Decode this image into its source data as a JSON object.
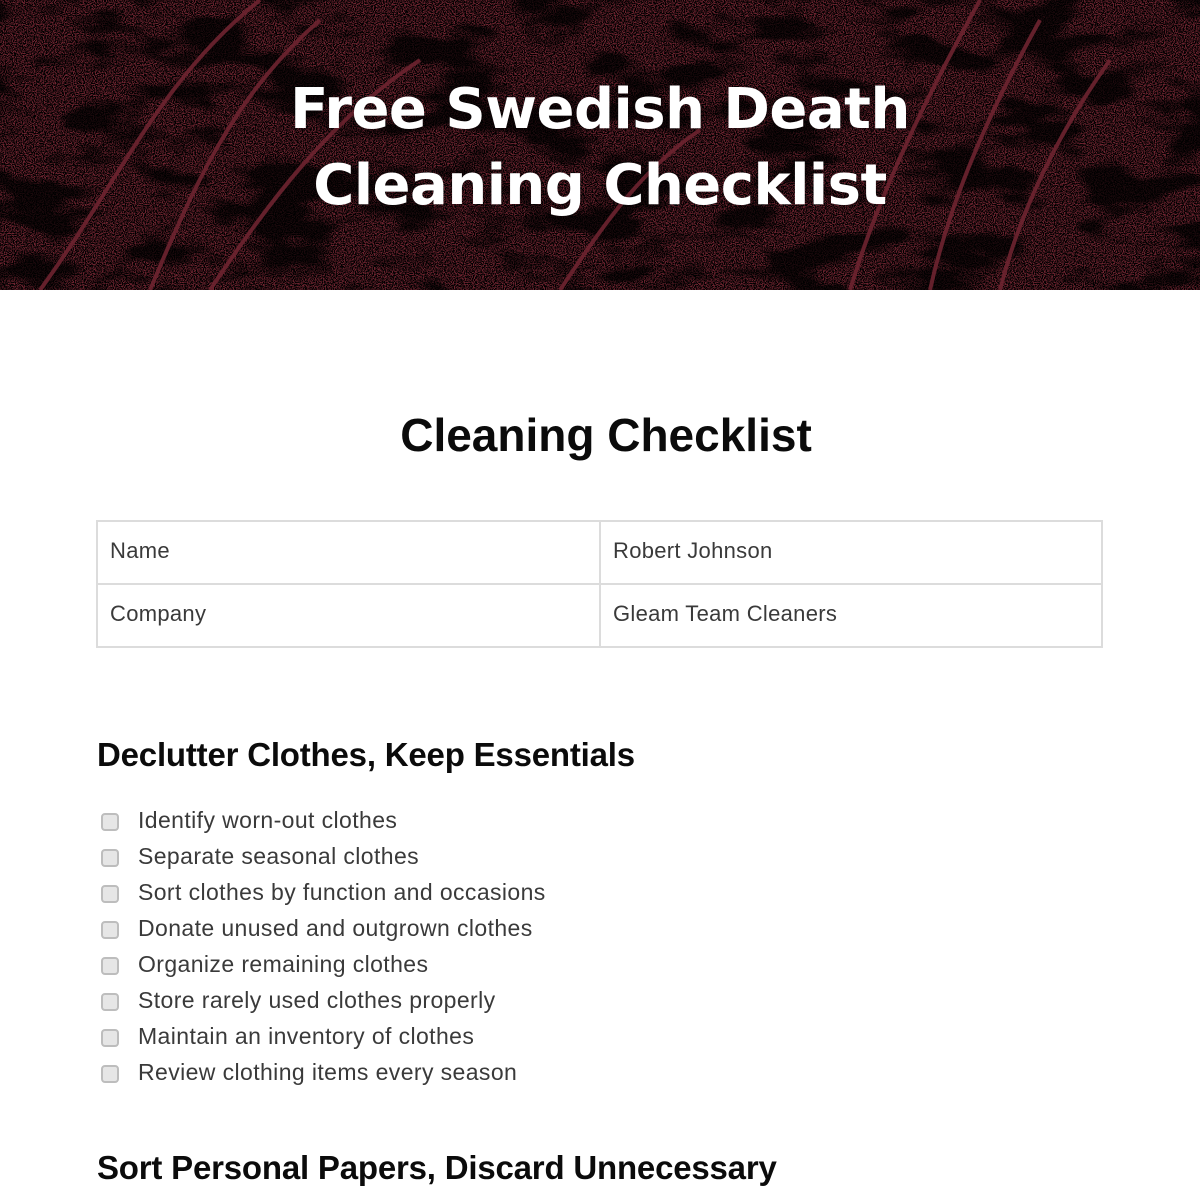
{
  "banner": {
    "title_line1": "Free Swedish Death",
    "title_line2": "Cleaning Checklist",
    "background_color": "#6e2430",
    "texture_color": "#000000"
  },
  "document": {
    "title": "Cleaning Checklist",
    "info_table": [
      {
        "label": "Name",
        "value": "Robert Johnson"
      },
      {
        "label": "Company",
        "value": "Gleam Team Cleaners"
      }
    ],
    "sections": [
      {
        "heading": "Declutter Clothes, Keep Essentials",
        "items": [
          {
            "label": "Identify worn-out clothes",
            "checked": false
          },
          {
            "label": "Separate seasonal clothes",
            "checked": false
          },
          {
            "label": "Sort clothes by function and occasions",
            "checked": false
          },
          {
            "label": "Donate unused and outgrown clothes",
            "checked": false
          },
          {
            "label": "Organize remaining clothes",
            "checked": false
          },
          {
            "label": "Store rarely used clothes properly",
            "checked": false
          },
          {
            "label": "Maintain an inventory of clothes",
            "checked": false
          },
          {
            "label": "Review clothing items every season",
            "checked": false
          }
        ]
      },
      {
        "heading": "Sort Personal Papers, Discard Unnecessary",
        "items": []
      }
    ]
  }
}
